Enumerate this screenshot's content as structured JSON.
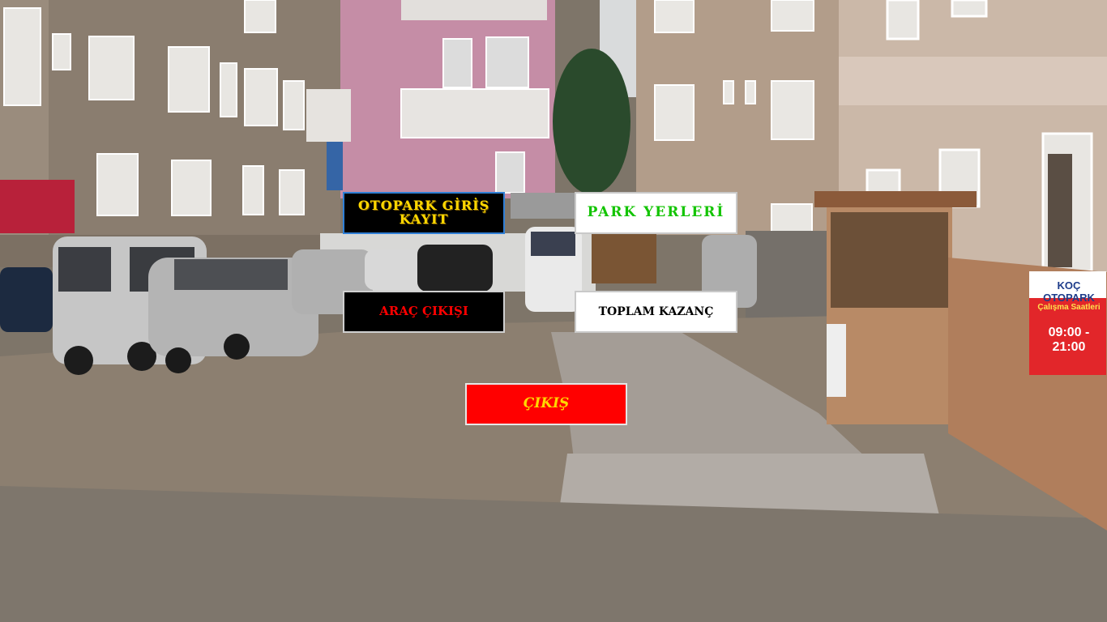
{
  "buttons": {
    "entry_label": "OTOPARK GİRİŞ KAYIT",
    "park_spaces_label": "PARK YERLERİ",
    "vehicle_exit_label": "ARAÇ ÇIKIŞI",
    "total_earnings_label": "TOPLAM KAZANÇ",
    "quit_label": "ÇIKIŞ"
  },
  "background_sign": {
    "name": "KOÇ OTOPARK",
    "hours_caption": "Çalışma Saatleri",
    "hours": "09:00 - 21:00"
  },
  "colors": {
    "entry_text": "#ffd800",
    "park_text": "#12c400",
    "exit_text": "#ff0000",
    "quit_bg": "#ff0000"
  }
}
